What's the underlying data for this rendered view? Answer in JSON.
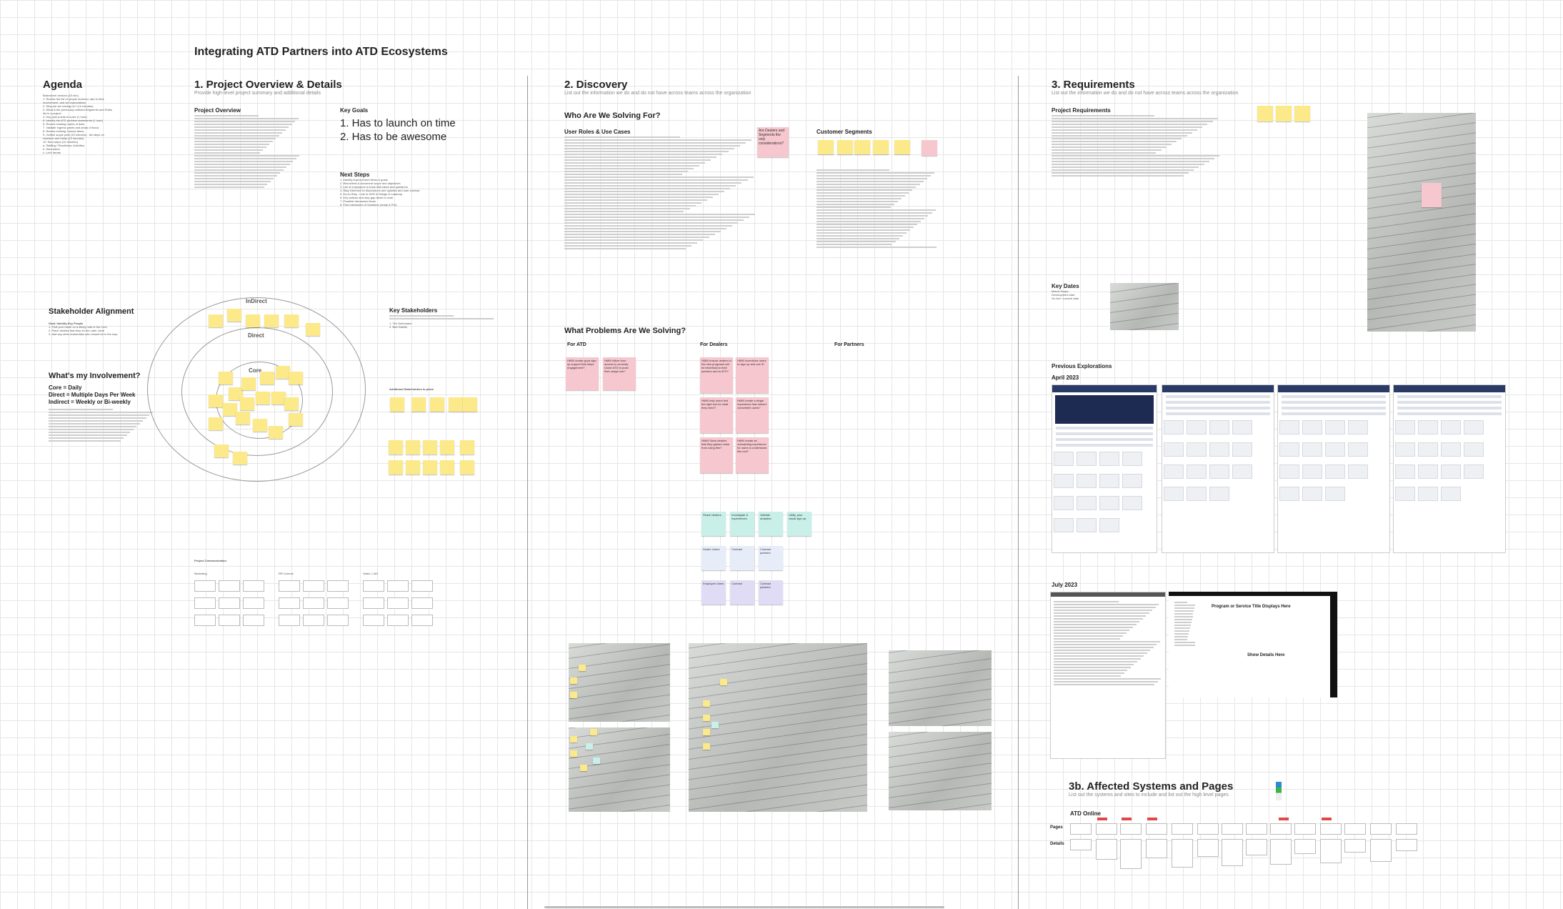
{
  "board_title": "Integrating ATD Partners into ATD Ecosystems",
  "agenda": {
    "title": "Agenda",
    "lines": [
      "Brainstorm session (15 min)",
      "1. Review the list of people involved, add to their",
      "   involvement, and set expectations",
      "2. Why are we solving for? (10 minutes)",
      "3. What is the previously outlined Segments and Roles",
      "   list in a project",
      "4. Key pain points to solve (1 hour)",
      "5. Identify the ATD problem statements (1 hour)",
      "6. Review existing routes of data",
      "7. Validate ingress points and areas of focus",
      "8. Review existing Journal Items",
      "9. Outline scope path (15 minutes) - list steps on",
      "   research and ideas (10 minutes)",
      "10. Next steps (10 minutes)",
      "   a. Staffing / Readiness, Activities",
      "   b. Discussion",
      "   c. Let's Iterate"
    ]
  },
  "sections": {
    "overview": {
      "title": "1. Project Overview & Details",
      "subtitle": "Provide high-level project summary and additional details"
    },
    "discovery": {
      "title": "2. Discovery",
      "subtitle": "List out the information we do and do not have across teams across the organization"
    },
    "requirements": {
      "title": "3. Requirements",
      "subtitle": "List out the information we do and do not have across teams across the organization"
    },
    "affected": {
      "title": "3b. Affected Systems and Pages",
      "subtitle": "List out the systems and sites to include and list out the high level pages"
    }
  },
  "project_overview": {
    "title": "Project Overview"
  },
  "key_goals": {
    "title": "Key Goals",
    "items": [
      "1. Has to launch on time",
      "2. Has to be awesome"
    ]
  },
  "next_steps": {
    "title": "Next Steps",
    "items": [
      "1. Identify improvement items & goals",
      "2. Recon/test & document scope and objectives",
      "3. List of employees to track interviews and questions",
      "4. Stay informed for discussions and updates and user surveys",
      "5. Go-to-Ship - Link to OKR & Design & roadmap",
      "6. Key actions and stop-gap items to work",
      "7. Possible discussion items",
      "8. First milestones of Solutions (ready & Pre)"
    ]
  },
  "stakeholder_alignment": {
    "title": "Stakeholder Alignment",
    "goal": "Goal: Identify Key People",
    "steps": [
      "1. Find your name on a sticky note in the Core",
      "2. Place stickies that they do the outer circle",
      "3. Add any other teammates who should be in the loop"
    ]
  },
  "involvement": {
    "title": "What's my Involvement?",
    "core": "Core = Daily",
    "direct": "Direct = Multiple Days Per Week",
    "indirect": "Indirect = Weekly or Bi-weekly"
  },
  "circles": {
    "outer": "InDirect",
    "middle": "Direct",
    "inner": "Core"
  },
  "key_stakeholders": {
    "title": "Key Stakeholders",
    "items": [
      "1. Tim Hoehmann",
      "2. Bob Hamlin"
    ]
  },
  "additional_stakeholders": {
    "title": "Additional Stakeholders to place"
  },
  "project_communication": {
    "title": "Project Communication",
    "groups": [
      "Marketing",
      "RR Comms",
      "Sales / L&D"
    ]
  },
  "who_solving": {
    "title": "Who Are We Solving For?",
    "roles_title": "User Roles & Use Cases"
  },
  "customer_segments": {
    "title": "Customer Segments"
  },
  "roles_sticky": "Are Dealers and Segments the only considerations?",
  "problems": {
    "title": "What Problems Are We Solving?",
    "cols": [
      "For ATD",
      "For Dealers",
      "For Partners"
    ]
  },
  "atd_stickies": [
    "HMW create good sign up support that helps engagement?",
    "HMW utilize from access to currently Under ATD to push their usage use?"
  ],
  "dealer_stickies": [
    "HMW ensure dealers in the new programs will be beneficial to their partners and to ATD?",
    "HMW incentivize users to sign up and use it?",
    "HMW help users find the right tool for what they need?",
    "HMW create a single experience that doesn't overwhelm users?",
    "HMW Show dealers that they gained value from using this?",
    "HMW create an onboarding experience for users to understand this tool?"
  ],
  "teal_stickies": [
    "Reach dealers",
    "Investigate & experiences",
    "Validate analytics",
    "Utility, plus visual sign up"
  ],
  "blue_stickies": [
    "Dealer Users",
    "Contract",
    "Contract partners"
  ],
  "lav_stickies": [
    "Employee Users",
    "Contract",
    "Contract partners"
  ],
  "project_requirements": {
    "title": "Project Requirements"
  },
  "key_dates": {
    "title": "Key Dates",
    "lines": [
      "March Scope",
      "Development start",
      "Go-live / Launch date"
    ]
  },
  "previous_explorations": {
    "title": "Previous Explorations",
    "april": "April 2023",
    "july": "July 2023"
  },
  "wireframe": {
    "heading": "Program or Service Title Displays Here",
    "body": "Show Details Here"
  },
  "atd_online": {
    "title": "ATD Online",
    "pages_label": "Pages",
    "details_label": "Details"
  },
  "colors": {
    "sticky_yellow": "#fbe98a",
    "sticky_pink": "#f6c7cf",
    "sticky_teal": "#c9efe9",
    "sticky_lavender": "#e1dcf5",
    "brand_navy": "#2a3a66",
    "tag_red": "#e04848"
  }
}
